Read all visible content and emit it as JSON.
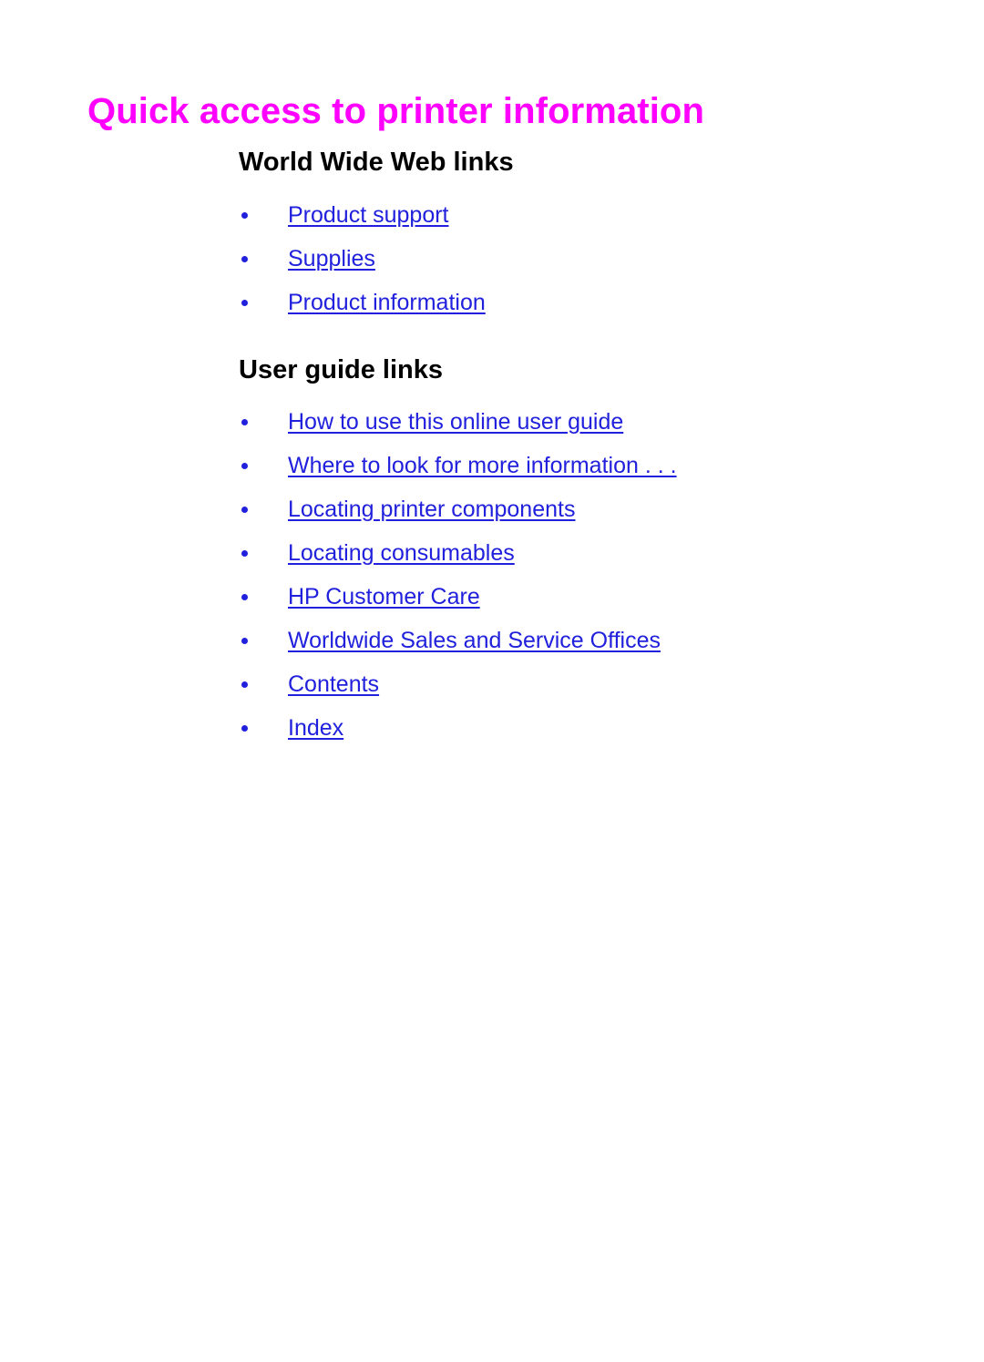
{
  "document": {
    "title": "Quick access to printer information",
    "title_color": "#ff00ff",
    "link_color": "#2020dd",
    "heading_color": "#000000",
    "background_color": "#ffffff"
  },
  "sections": [
    {
      "heading": "World Wide Web links",
      "links": [
        {
          "label": "Product support"
        },
        {
          "label": "Supplies"
        },
        {
          "label": "Product information"
        }
      ]
    },
    {
      "heading": "User guide links",
      "links": [
        {
          "label": "How to use this online user guide"
        },
        {
          "label": "Where to look for more information . . ."
        },
        {
          "label": "Locating printer components"
        },
        {
          "label": "Locating consumables"
        },
        {
          "label": "HP Customer Care"
        },
        {
          "label": "Worldwide Sales and Service Offices"
        },
        {
          "label": "Contents"
        },
        {
          "label": "Index"
        }
      ]
    }
  ]
}
